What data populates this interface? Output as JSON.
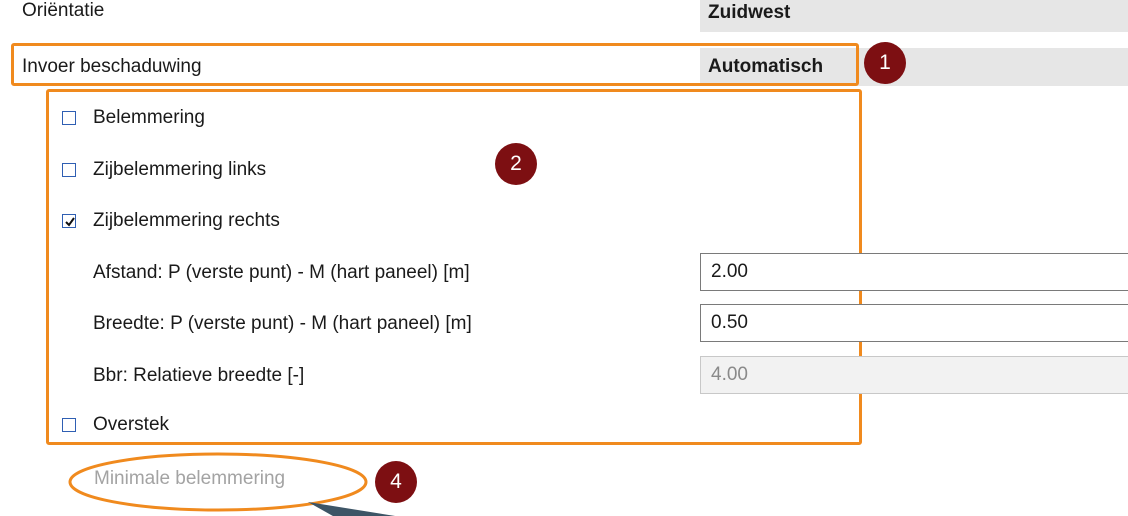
{
  "orientation": {
    "label": "Oriëntatie",
    "value": "Zuidwest"
  },
  "shading_input": {
    "label": "Invoer beschaduwing",
    "value": "Automatisch"
  },
  "checkboxes": {
    "obstruction": {
      "label": "Belemmering",
      "checked": false
    },
    "side_left": {
      "label": "Zijbelemmering links",
      "checked": false
    },
    "side_right": {
      "label": "Zijbelemmering rechts",
      "checked": true
    },
    "overhang": {
      "label": "Overstek",
      "checked": false
    }
  },
  "fields": {
    "distance": {
      "label": "Afstand: P (verste punt) -  M (hart paneel) [m]",
      "value": "2.00"
    },
    "width": {
      "label": "Breedte: P (verste punt) - M (hart paneel) [m]",
      "value": "0.50"
    },
    "relative_width": {
      "label": "Bbr: Relatieve breedte [-]",
      "value": "4.00"
    }
  },
  "min_obstruction": {
    "label": "Minimale belemmering"
  },
  "annotations": {
    "badge_1": "1",
    "badge_2": "2",
    "badge_4": "4"
  },
  "colors": {
    "highlight": "#f08a1e",
    "badge": "#7d0f12",
    "checkbox": "#2f5fb3"
  }
}
